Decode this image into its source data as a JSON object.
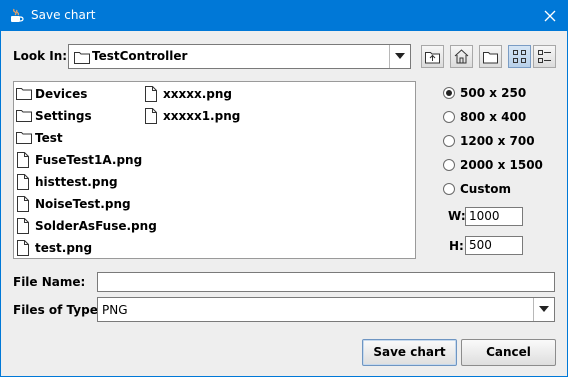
{
  "window": {
    "title": "Save chart"
  },
  "look_in": {
    "label": "Look In:",
    "value": "TestController"
  },
  "toolbar": {
    "up_folder": "up-one-level",
    "home": "home",
    "new_folder": "create-new-folder",
    "list_view": "list",
    "details_view": "details"
  },
  "files": {
    "col1": [
      {
        "name": "Devices",
        "type": "folder"
      },
      {
        "name": "Settings",
        "type": "folder"
      },
      {
        "name": "Test",
        "type": "folder"
      },
      {
        "name": "FuseTest1A.png",
        "type": "file"
      },
      {
        "name": "histtest.png",
        "type": "file"
      },
      {
        "name": "NoiseTest.png",
        "type": "file"
      },
      {
        "name": "SolderAsFuse.png",
        "type": "file"
      },
      {
        "name": "test.png",
        "type": "file"
      }
    ],
    "col2": [
      {
        "name": "xxxxx.png",
        "type": "file"
      },
      {
        "name": "xxxxx1.png",
        "type": "file"
      }
    ]
  },
  "size_options": [
    {
      "label": "500 x 250",
      "selected": true
    },
    {
      "label": "800 x 400",
      "selected": false
    },
    {
      "label": "1200 x 700",
      "selected": false
    },
    {
      "label": "2000 x 1500",
      "selected": false
    },
    {
      "label": "Custom",
      "selected": false
    }
  ],
  "custom": {
    "w_label": "W:",
    "w_value": "1000",
    "h_label": "H:",
    "h_value": "500"
  },
  "file_name": {
    "label": "File Name:",
    "value": ""
  },
  "file_type": {
    "label": "Files of Type:",
    "value": "PNG"
  },
  "buttons": {
    "save": "Save chart",
    "cancel": "Cancel"
  },
  "colors": {
    "titlebar": "#0078d7",
    "background": "#eeeeee"
  }
}
